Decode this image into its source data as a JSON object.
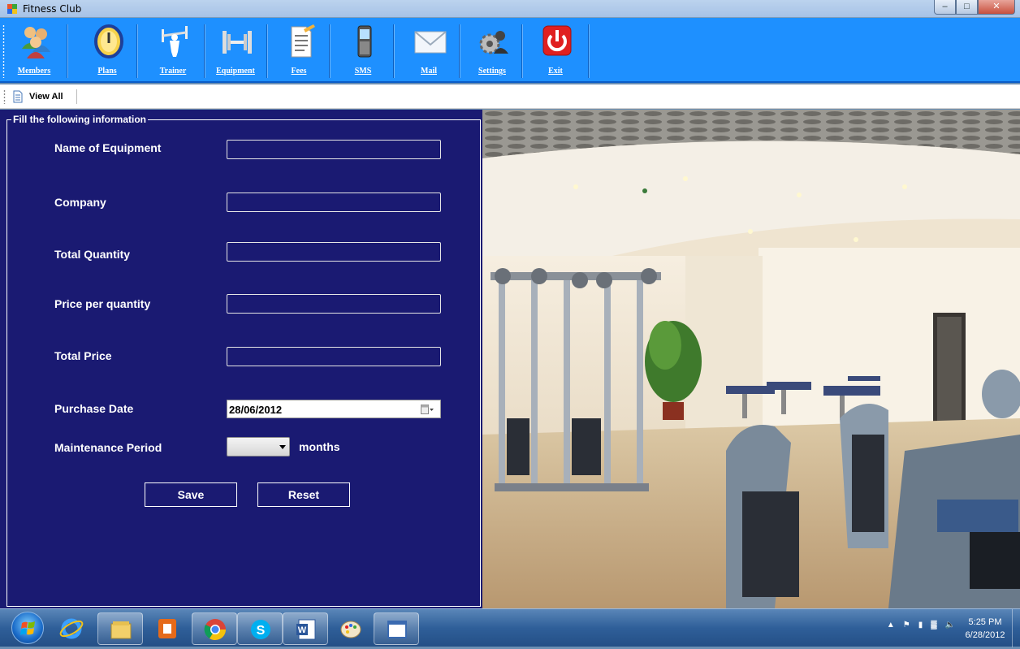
{
  "window": {
    "title": "Fitness Club"
  },
  "toolbar": {
    "items": [
      {
        "label": "Members",
        "icon": "members-icon"
      },
      {
        "label": "Plans",
        "icon": "plans-icon"
      },
      {
        "label": "Trainer",
        "icon": "trainer-icon"
      },
      {
        "label": "Equipment",
        "icon": "equipment-icon"
      },
      {
        "label": "Fees",
        "icon": "fees-icon"
      },
      {
        "label": "SMS",
        "icon": "sms-icon"
      },
      {
        "label": "Mail",
        "icon": "mail-icon"
      },
      {
        "label": "Settings",
        "icon": "settings-icon"
      },
      {
        "label": "Exit",
        "icon": "power-icon"
      }
    ]
  },
  "subbar": {
    "view_all": "View All"
  },
  "form": {
    "legend": "Fill the following information",
    "fields": {
      "name_of_equipment": {
        "label": "Name of Equipment",
        "value": ""
      },
      "company": {
        "label": "Company",
        "value": ""
      },
      "total_quantity": {
        "label": "Total Quantity",
        "value": ""
      },
      "price_per_quantity": {
        "label": "Price per quantity",
        "value": ""
      },
      "total_price": {
        "label": "Total Price",
        "value": ""
      },
      "purchase_date": {
        "label": "Purchase Date",
        "value": "28/06/2012"
      },
      "maintenance_period": {
        "label": "Maintenance Period",
        "value": "",
        "unit": "months"
      }
    },
    "save_label": "Save",
    "reset_label": "Reset"
  },
  "taskbar": {
    "clock_time": "5:25 PM",
    "clock_date": "6/28/2012"
  },
  "colors": {
    "toolbar_bg": "#1e90ff",
    "form_bg": "#1a1a72",
    "exit_red": "#e02020"
  }
}
